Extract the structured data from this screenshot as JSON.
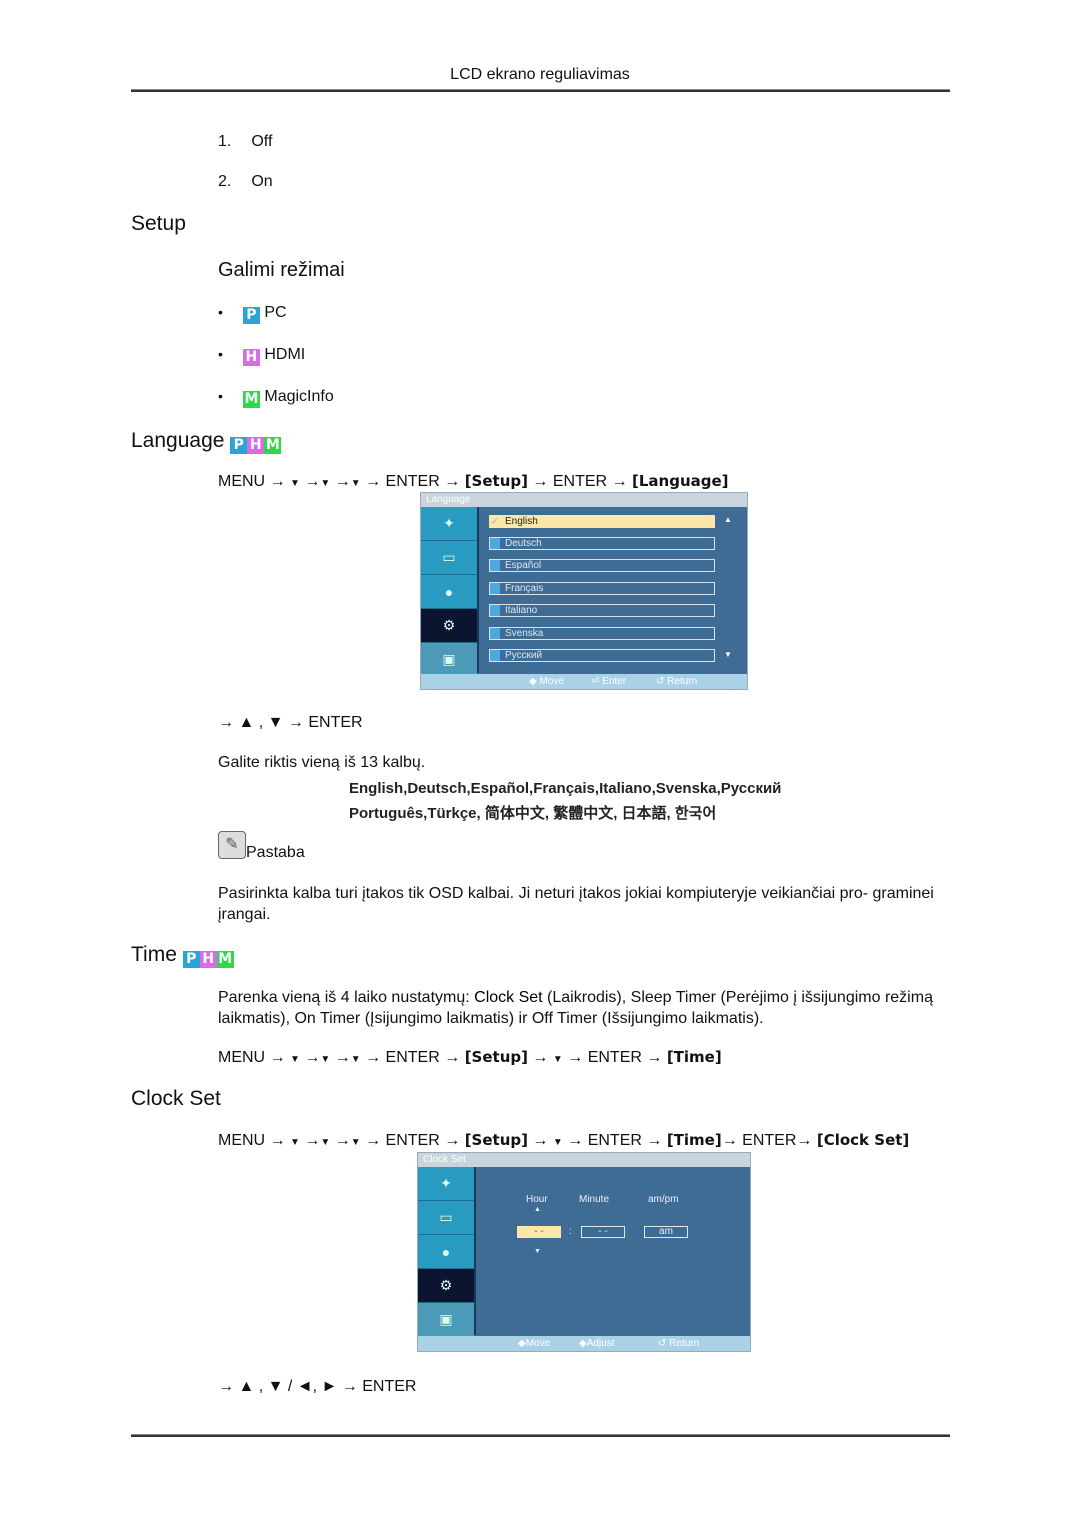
{
  "header": {
    "title": "LCD ekrano reguliavimas"
  },
  "list_onoff": [
    {
      "num": "1.",
      "label": "Off"
    },
    {
      "num": "2.",
      "label": "On"
    }
  ],
  "setup": {
    "title": "Setup",
    "modes_title": "Galimi režimai",
    "modes": [
      {
        "badge": "P",
        "label": "PC",
        "color": "#2aa3d6"
      },
      {
        "badge": "H",
        "label": "HDMI",
        "color": "#d96ae8"
      },
      {
        "badge": "M",
        "label": "MagicInfo",
        "color": "#2fd84a"
      }
    ]
  },
  "language": {
    "title": "Language",
    "path": {
      "menu": "MENU",
      "arrow": "→",
      "down": "▼",
      "enter": "ENTER",
      "setup": "[Setup]",
      "language": "[Language]"
    },
    "osd": {
      "title": "Language",
      "items": [
        "English",
        "Deutsch",
        "Español",
        "Français",
        "Italiano",
        "Svenska",
        "Русский"
      ],
      "selected": "English",
      "footer": {
        "move": "Move",
        "enter": "Enter",
        "return": "Return"
      }
    },
    "nav": "→ ▲ , ▼ → ENTER",
    "desc": "Galite riktis vieną iš 13 kalbų.",
    "langs_line1": "English,Deutsch,Español,Français,Italiano,Svenska,Русский",
    "langs_line2": "Português,Türkçe, 简体中文,  繁體中文, 日本語, 한국어",
    "note_label": "Pastaba",
    "note_text": "Pasirinkta kalba turi įtakos tik OSD kalbai. Ji neturi įtakos jokiai kompiuteryje veikiančiai pro- graminei įrangai."
  },
  "time": {
    "title": "Time",
    "desc_parts": [
      "Parenka vieną iš 4 laiko nustatymų: ",
      "Clock Set",
      " (Laikrodis), ",
      "Sleep Timer",
      " (Perėjimo į išsijungimo režimą laikmatis), ",
      "On Timer",
      " (Įsijungimo laikmatis) ir ",
      "Off Timer",
      " (Išsijungimo laikmatis)."
    ],
    "path_time": "[Time]"
  },
  "clock_set": {
    "title": "Clock Set",
    "path_clock": "[Clock Set]",
    "osd": {
      "title": "Clock Set",
      "hour_label": "Hour",
      "minute_label": "Minute",
      "ampm_label": "am/pm",
      "hour_value": "- -",
      "minute_value": "- -",
      "ampm_value": "am",
      "footer": {
        "move": "Move",
        "adjust": "Adjust",
        "return": "Return"
      }
    },
    "nav": "→ ▲ , ▼ / ◄, ► → ENTER"
  }
}
